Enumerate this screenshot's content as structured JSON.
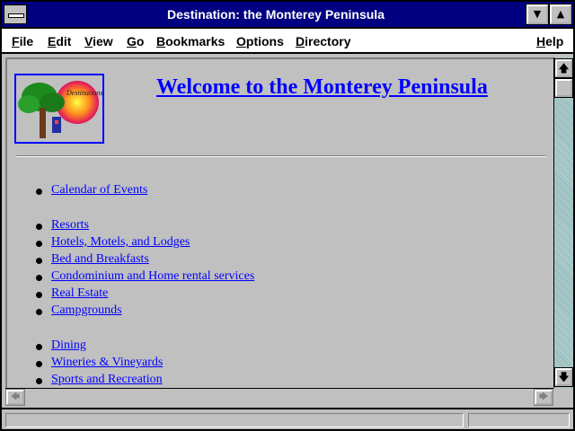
{
  "window": {
    "title": "Destination: the Monterey Peninsula"
  },
  "menu": [
    {
      "accel": "F",
      "rest": "ile"
    },
    {
      "accel": "E",
      "rest": "dit"
    },
    {
      "accel": "V",
      "rest": "iew"
    },
    {
      "accel": "G",
      "rest": "o"
    },
    {
      "accel": "B",
      "rest": "ookmarks"
    },
    {
      "accel": "O",
      "rest": "ptions"
    },
    {
      "accel": "D",
      "rest": "irectory"
    },
    {
      "accel": "H",
      "rest": "elp"
    }
  ],
  "page": {
    "heading": "Welcome to the Monterey Peninsula",
    "logo_text": "Destinations On-Line",
    "links": [
      "Calendar of Events",
      "Resorts",
      "Hotels, Motels, and Lodges",
      "Bed and Breakfasts",
      "Condominium and Home rental services",
      "Real Estate",
      "Campgrounds",
      "Dining",
      "Wineries & Vineyards",
      "Sports and Recreation"
    ]
  },
  "colors": {
    "titlebar": "#000080",
    "link": "#0000ff",
    "chrome": "#c0c0c0"
  },
  "icons": {
    "sysmenu": "system-menu-icon",
    "minimize": "minimize-arrow-icon",
    "maximize": "maximize-arrow-icon",
    "scroll_up": "arrow-up-icon",
    "scroll_down": "arrow-down-icon",
    "scroll_left": "arrow-left-icon",
    "scroll_right": "arrow-right-icon"
  }
}
